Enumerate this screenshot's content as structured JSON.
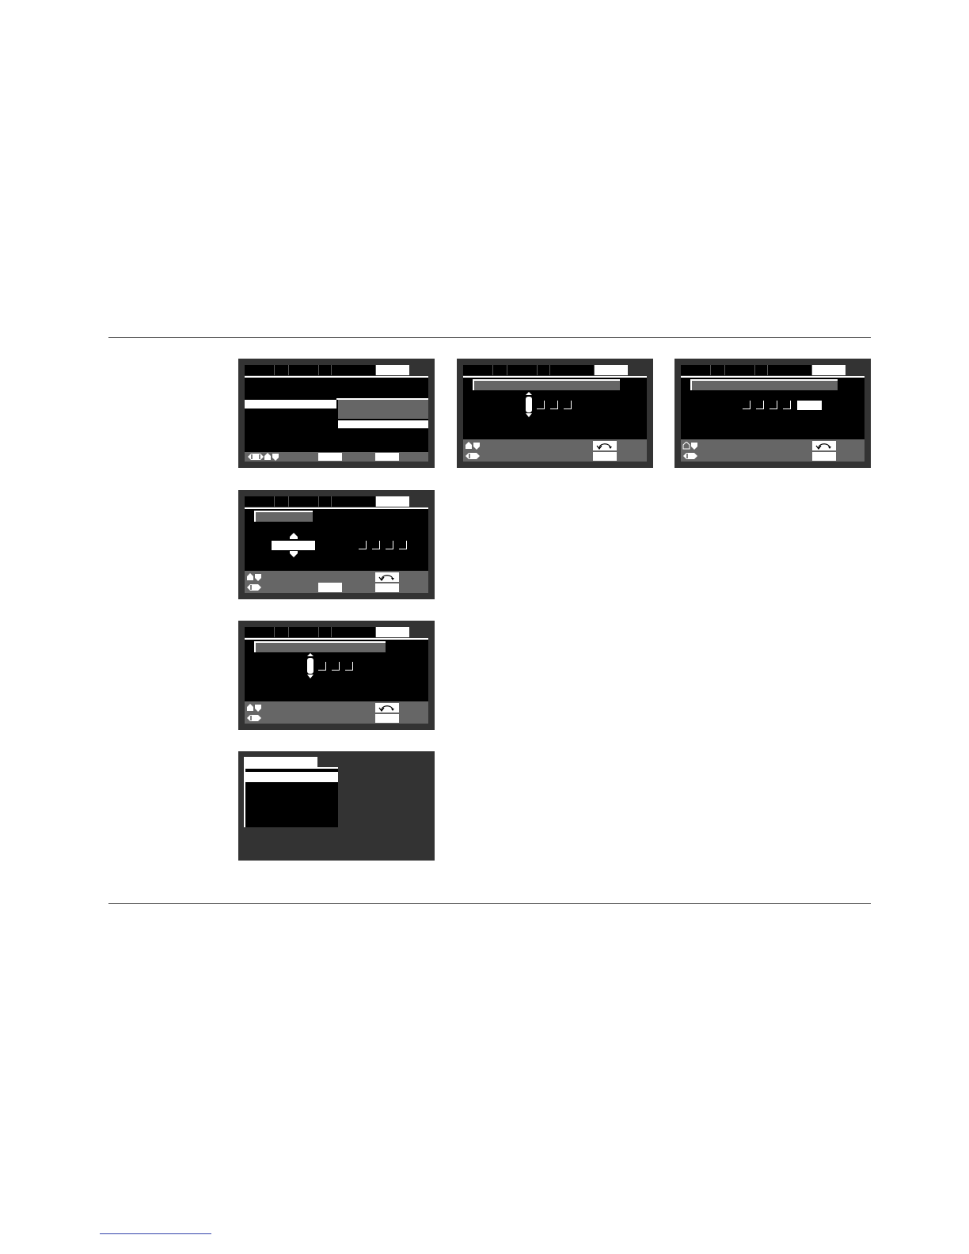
{
  "page": {
    "rule_top": "",
    "rule_bottom": ""
  },
  "colors": {
    "screen_bg": "#333333",
    "panel_black": "#000000",
    "panel_gray": "#666666",
    "highlight": "#ffffff",
    "link_underline": "#3344aa"
  },
  "icons": {
    "nav_left_right": "left-right-arrow-icon",
    "nav_up_down": "up-down-arrow-icon",
    "return": "return-arrow-icon",
    "spinner": "up-down-spinner-icon"
  },
  "screens": [
    {
      "name": "menu-screen",
      "labels": []
    },
    {
      "name": "code-entry-screen-a",
      "labels": []
    },
    {
      "name": "code-entry-screen-b",
      "labels": []
    },
    {
      "name": "setting-screen",
      "labels": []
    },
    {
      "name": "code-entry-screen-c",
      "labels": []
    },
    {
      "name": "list-screen",
      "labels": []
    }
  ]
}
